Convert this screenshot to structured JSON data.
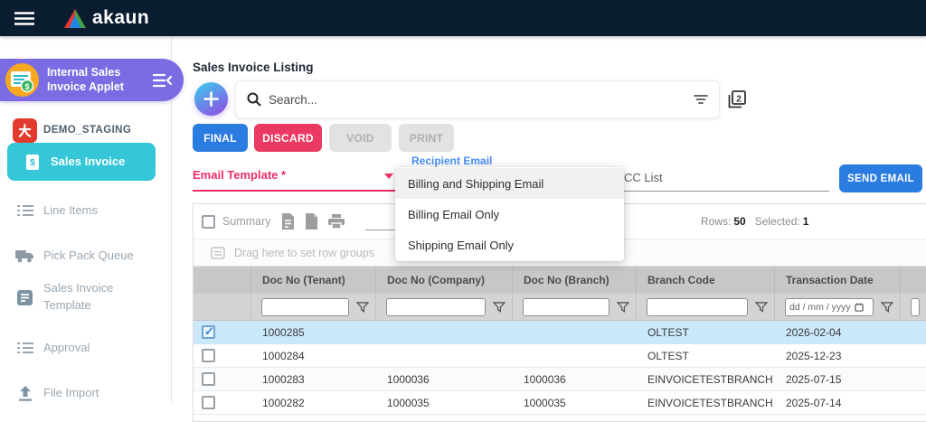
{
  "colors": {
    "topbar_bg": "#0a1c30",
    "applet_badge": "#7b6ce4",
    "active_item": "#35c6d8",
    "primary_blue": "#2b7ce0",
    "discard_pink": "#ea3a63",
    "template_pink": "#ee2f66",
    "recipient_blue": "#4a8df2",
    "selected_row": "#cbe8fa"
  },
  "topbar": {
    "brand": "akaun"
  },
  "sidebar": {
    "applet": {
      "title": "Internal Sales Invoice Applet"
    },
    "workspace": "DEMO_STAGING",
    "items": [
      {
        "label": "Sales Invoice",
        "active": true
      },
      {
        "label": "Line Items"
      },
      {
        "label": "Pick Pack Queue"
      },
      {
        "label": "Sales Invoice Template"
      },
      {
        "label": "Approval"
      },
      {
        "label": "File Import"
      }
    ]
  },
  "main": {
    "title": "Sales Invoice Listing",
    "search": {
      "placeholder": "Search..."
    },
    "actions": {
      "final": "FINAL",
      "discard": "DISCARD",
      "void": "VOID",
      "print": "PRINT"
    },
    "email_bar": {
      "template_label": "Email Template *",
      "recipient_label": "Recipient Email",
      "cc_label": "CC List",
      "send_button": "SEND EMAIL",
      "dropdown_options": [
        "Billing and Shipping Email",
        "Billing Email Only",
        "Shipping Email Only"
      ]
    },
    "grid": {
      "toolbar": {
        "summary_label": "Summary",
        "rows_label": "Rows:",
        "rows_value": "50",
        "selected_label": "Selected:",
        "selected_value": "1"
      },
      "drag_hint": "Drag here to set row groups",
      "columns": [
        "Doc No (Tenant)",
        "Doc No (Company)",
        "Doc No (Branch)",
        "Branch Code",
        "Transaction Date"
      ],
      "date_filter_placeholder": "dd / mm / yyyy",
      "rows": [
        {
          "checked": true,
          "selected": true,
          "doc_no_tenant": "1000285",
          "doc_no_company": "",
          "doc_no_branch": "",
          "branch_code": "OLTEST",
          "transaction_date": "2026-02-04"
        },
        {
          "checked": false,
          "doc_no_tenant": "1000284",
          "doc_no_company": "",
          "doc_no_branch": "",
          "branch_code": "OLTEST",
          "transaction_date": "2025-12-23"
        },
        {
          "checked": false,
          "doc_no_tenant": "1000283",
          "doc_no_company": "1000036",
          "doc_no_branch": "1000036",
          "branch_code": "EINVOICETESTBRANCH",
          "transaction_date": "2025-07-15"
        },
        {
          "checked": false,
          "doc_no_tenant": "1000282",
          "doc_no_company": "1000035",
          "doc_no_branch": "1000035",
          "branch_code": "EINVOICETESTBRANCH",
          "transaction_date": "2025-07-14"
        }
      ]
    }
  }
}
